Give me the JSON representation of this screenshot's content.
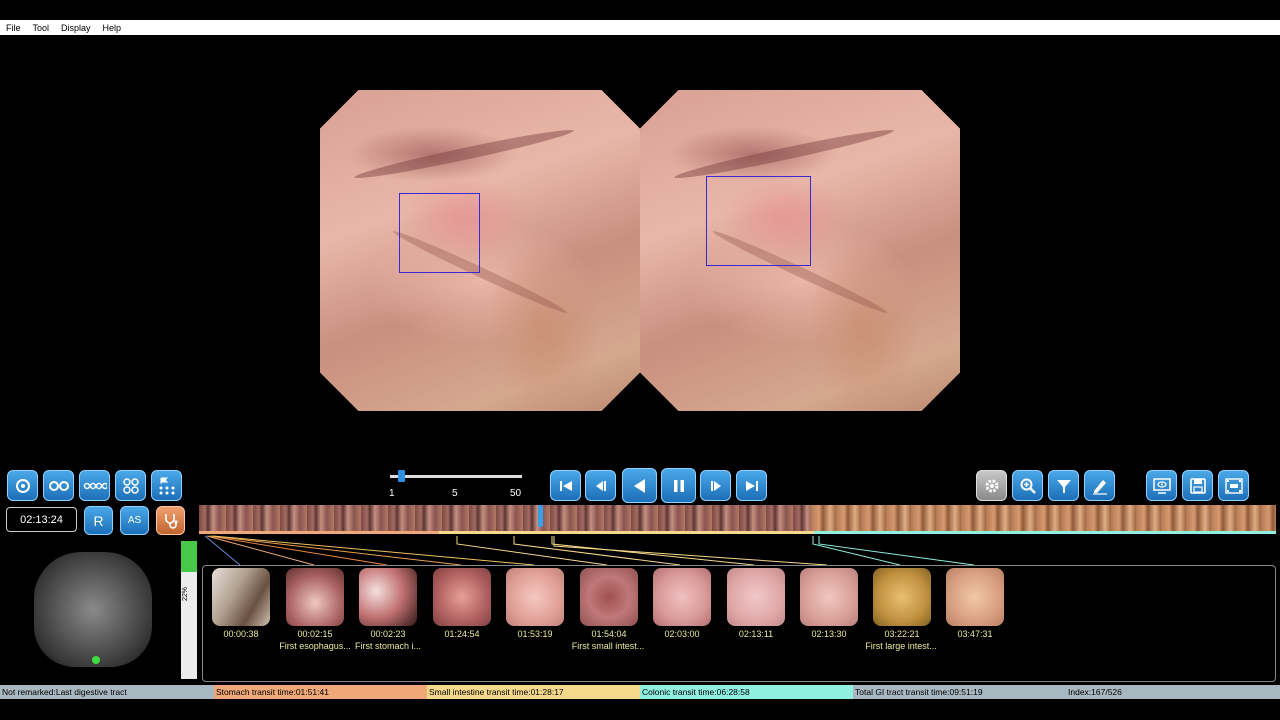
{
  "menu": {
    "file": "File",
    "tool": "Tool",
    "display": "Display",
    "help": "Help"
  },
  "speed": {
    "label_1": "1",
    "label_5": "5",
    "label_50": "50"
  },
  "current_time": "02:13:24",
  "buttons": {
    "r": "R",
    "as": "AS"
  },
  "progress_pct": "22%",
  "thumbnails": [
    {
      "time": "00:00:38",
      "caption": ""
    },
    {
      "time": "00:02:15",
      "caption": "First esophagus..."
    },
    {
      "time": "00:02:23",
      "caption": "First stomach i..."
    },
    {
      "time": "01:24:54",
      "caption": ""
    },
    {
      "time": "01:53:19",
      "caption": ""
    },
    {
      "time": "01:54:04",
      "caption": "First small intest..."
    },
    {
      "time": "02:03:00",
      "caption": ""
    },
    {
      "time": "02:13:11",
      "caption": ""
    },
    {
      "time": "02:13:30",
      "caption": ""
    },
    {
      "time": "03:22:21",
      "caption": "First large intest..."
    },
    {
      "time": "03:47:31",
      "caption": ""
    }
  ],
  "status": {
    "remark": "Not remarked:Last digestive tract",
    "stomach": "Stomach transit time:01:51:41",
    "small_intestine": "Small intestine transit time:01:28:17",
    "colonic": "Colonic transit time:06:28:58",
    "total": "Total GI tract transit time:09:51:19",
    "index": "Index:167/526"
  },
  "colors": {
    "accent_blue": "#1d6fb8",
    "stomach": "#f0a878",
    "small_intestine": "#f5d98a",
    "colonic": "#8ff0df",
    "gray_status": "#a8b8c0"
  }
}
